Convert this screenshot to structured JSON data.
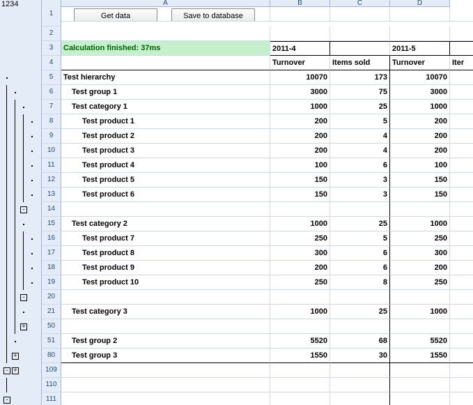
{
  "outline_levels": [
    "1",
    "2",
    "3",
    "4"
  ],
  "col_letters": {
    "A": "A",
    "B": "B",
    "C": "C",
    "D": "D"
  },
  "buttons": {
    "get_data": "Get data",
    "save_db": "Save to database"
  },
  "status": "Calculation finished: 37ms",
  "header1": {
    "b": "2011-4",
    "c": "",
    "d": "2011-5",
    "e": ""
  },
  "header2": {
    "b": "Turnover",
    "c": "Items sold",
    "d": "Turnover",
    "e": "Iter"
  },
  "rows": [
    {
      "rn": "5",
      "a": "Test hierarchy",
      "b": "10070",
      "c": "173",
      "d": "10070",
      "bold": true,
      "indent": 0
    },
    {
      "rn": "6",
      "a": "Test group 1",
      "b": "3000",
      "c": "75",
      "d": "3000",
      "bold": true,
      "indent": 1
    },
    {
      "rn": "7",
      "a": "Test category 1",
      "b": "1000",
      "c": "25",
      "d": "1000",
      "bold": true,
      "indent": 1
    },
    {
      "rn": "8",
      "a": "Test product 1",
      "b": "200",
      "c": "5",
      "d": "200",
      "bold": true,
      "indent": 2
    },
    {
      "rn": "9",
      "a": "Test product 2",
      "b": "200",
      "c": "4",
      "d": "200",
      "bold": true,
      "indent": 2
    },
    {
      "rn": "10",
      "a": "Test product 3",
      "b": "200",
      "c": "4",
      "d": "200",
      "bold": true,
      "indent": 2
    },
    {
      "rn": "11",
      "a": "Test product 4",
      "b": "100",
      "c": "6",
      "d": "100",
      "bold": true,
      "indent": 2
    },
    {
      "rn": "12",
      "a": "Test product 5",
      "b": "150",
      "c": "3",
      "d": "150",
      "bold": true,
      "indent": 2
    },
    {
      "rn": "13",
      "a": "Test product 6",
      "b": "150",
      "c": "3",
      "d": "150",
      "bold": true,
      "indent": 2
    },
    {
      "rn": "14",
      "a": "",
      "b": "",
      "c": "",
      "d": "",
      "bold": false,
      "indent": 0
    },
    {
      "rn": "15",
      "a": "Test category 2",
      "b": "1000",
      "c": "25",
      "d": "1000",
      "bold": true,
      "indent": 1
    },
    {
      "rn": "16",
      "a": "Test product 7",
      "b": "250",
      "c": "5",
      "d": "250",
      "bold": true,
      "indent": 2
    },
    {
      "rn": "17",
      "a": "Test product 8",
      "b": "300",
      "c": "6",
      "d": "300",
      "bold": true,
      "indent": 2
    },
    {
      "rn": "18",
      "a": "Test product 9",
      "b": "200",
      "c": "6",
      "d": "200",
      "bold": true,
      "indent": 2
    },
    {
      "rn": "19",
      "a": "Test product 10",
      "b": "250",
      "c": "8",
      "d": "250",
      "bold": true,
      "indent": 2
    },
    {
      "rn": "20",
      "a": "",
      "b": "",
      "c": "",
      "d": "",
      "bold": false,
      "indent": 0
    },
    {
      "rn": "21",
      "a": "Test category 3",
      "b": "1000",
      "c": "25",
      "d": "1000",
      "bold": true,
      "indent": 1
    },
    {
      "rn": "50",
      "a": "",
      "b": "",
      "c": "",
      "d": "",
      "bold": false,
      "indent": 0
    },
    {
      "rn": "51",
      "a": "Test group 2",
      "b": "5520",
      "c": "68",
      "d": "5520",
      "bold": true,
      "indent": 1
    },
    {
      "rn": "80",
      "a": "Test group 3",
      "b": "1550",
      "c": "30",
      "d": "1550",
      "bold": true,
      "indent": 1,
      "bottom": true
    },
    {
      "rn": "109",
      "a": "",
      "b": "",
      "c": "",
      "d": "",
      "bold": false,
      "indent": 0
    },
    {
      "rn": "110",
      "a": "",
      "b": "",
      "c": "",
      "d": "",
      "bold": false,
      "indent": 0
    },
    {
      "rn": "111",
      "a": "",
      "b": "",
      "c": "",
      "d": "",
      "bold": false,
      "indent": 0
    }
  ],
  "outline": {
    "5": {
      "l1": "dot"
    },
    "6": {
      "l1": "line",
      "l2": "dot"
    },
    "7": {
      "l1": "line",
      "l2": "line",
      "l3": "dot"
    },
    "8": {
      "l1": "line",
      "l2": "line",
      "l3": "line",
      "l4": "dot"
    },
    "9": {
      "l1": "line",
      "l2": "line",
      "l3": "line",
      "l4": "dot"
    },
    "10": {
      "l1": "line",
      "l2": "line",
      "l3": "line",
      "l4": "dot"
    },
    "11": {
      "l1": "line",
      "l2": "line",
      "l3": "line",
      "l4": "dot"
    },
    "12": {
      "l1": "line",
      "l2": "line",
      "l3": "line",
      "l4": "dot"
    },
    "13": {
      "l1": "line",
      "l2": "line",
      "l3": "line",
      "l4": "dot"
    },
    "14": {
      "l1": "line",
      "l2": "line",
      "l3": "minus"
    },
    "15": {
      "l1": "line",
      "l2": "line",
      "l3": "dot"
    },
    "16": {
      "l1": "line",
      "l2": "line",
      "l3": "line",
      "l4": "dot"
    },
    "17": {
      "l1": "line",
      "l2": "line",
      "l3": "line",
      "l4": "dot"
    },
    "18": {
      "l1": "line",
      "l2": "line",
      "l3": "line",
      "l4": "dot"
    },
    "19": {
      "l1": "line",
      "l2": "line",
      "l3": "line",
      "l4": "dot"
    },
    "20": {
      "l1": "line",
      "l2": "line",
      "l3": "minus"
    },
    "21": {
      "l1": "line",
      "l2": "line",
      "l3": "dot"
    },
    "50": {
      "l1": "line",
      "l2": "line",
      "l3": "plus"
    },
    "51": {
      "l1": "line",
      "l2": "dot"
    },
    "80": {
      "l1": "line",
      "l2": "plus"
    },
    "109": {
      "l1": "minus",
      "l2": "plus"
    },
    "110": {
      "l1": "line"
    },
    "111": {
      "l1": "minus"
    }
  }
}
